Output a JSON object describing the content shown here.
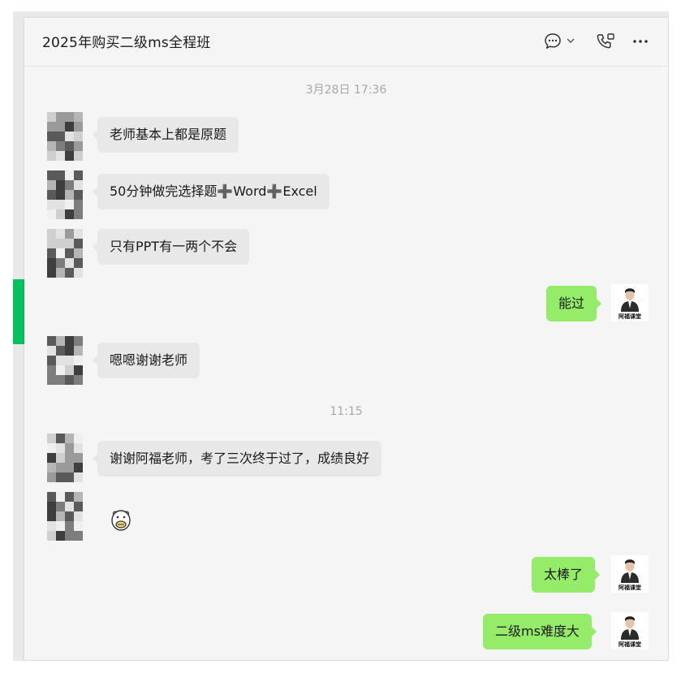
{
  "header": {
    "title": "2025年购买二级ms全程班",
    "icons": [
      "chat-bubble-icon",
      "chevron-down-icon",
      "voice-call-icon",
      "more-icon"
    ]
  },
  "timestamps": [
    "3月28日 17:36",
    "11:15"
  ],
  "messages": [
    {
      "side": "left",
      "text": "老师基本上都是原题"
    },
    {
      "side": "left",
      "text": "50分钟做完选择题➕Word➕Excel"
    },
    {
      "side": "left",
      "text": "只有PPT有一两个不会"
    },
    {
      "side": "right",
      "text": "能过"
    },
    {
      "side": "left",
      "text": "嗯嗯谢谢老师"
    },
    {
      "side": "left",
      "text": "谢谢阿福老师，考了三次终于过了，成绩良好"
    },
    {
      "side": "left",
      "text": "",
      "sticker": "cartoon-sticker"
    },
    {
      "side": "right",
      "text": "太棒了"
    },
    {
      "side": "right",
      "text": "二级ms难度大"
    }
  ],
  "my_avatar_caption": "阿福课堂",
  "colors": {
    "accent": "#07c160",
    "bubble_in": "#e8e8e9",
    "bubble_out": "#95ec69",
    "background": "#f5f5f5"
  }
}
